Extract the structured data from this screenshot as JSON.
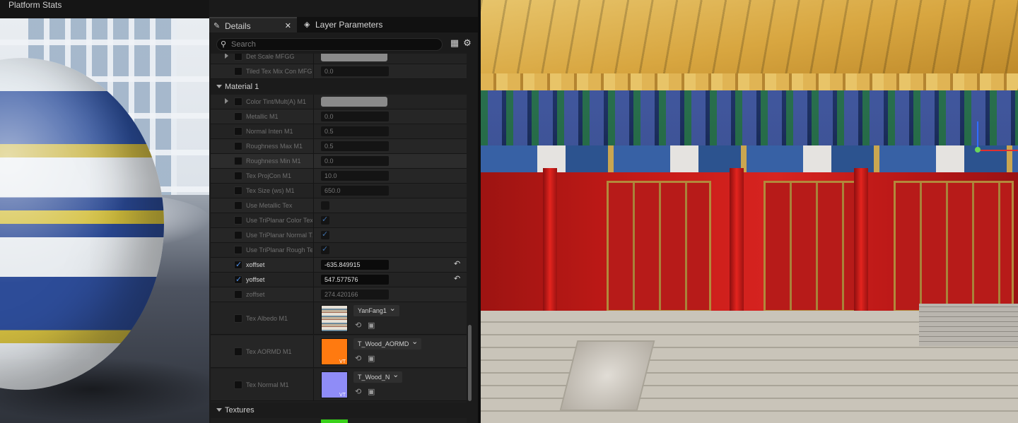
{
  "left_viewport": {
    "title": "Platform Stats"
  },
  "details_panel": {
    "tabs": [
      {
        "label": "Details",
        "icon": "pencil-icon",
        "closable": true
      },
      {
        "label": "Layer Parameters",
        "icon": "layers-icon"
      }
    ],
    "search": {
      "placeholder": "Search"
    },
    "toolbar_icons": [
      "table-view-icon",
      "settings-gear-icon"
    ],
    "rows_top": [
      {
        "label": "Det Scale MFGG",
        "type": "color"
      },
      {
        "label": "Tiled Tex Mix Con MFGG",
        "type": "number",
        "value": "0.0"
      }
    ],
    "category_material": {
      "label": "Material 1"
    },
    "material_rows": [
      {
        "label": "Color Tint/Mult(A) M1",
        "type": "color",
        "expandable": true
      },
      {
        "label": "Metallic M1",
        "type": "number",
        "value": "0.0"
      },
      {
        "label": "Normal Inten M1",
        "type": "number",
        "value": "0.5"
      },
      {
        "label": "Roughness Max M1",
        "type": "number",
        "value": "0.5"
      },
      {
        "label": "Roughness Min M1",
        "type": "number",
        "value": "0.0"
      },
      {
        "label": "Tex ProjCon M1",
        "type": "number",
        "value": "10.0"
      },
      {
        "label": "Tex Size (ws) M1",
        "type": "number",
        "value": "650.0"
      },
      {
        "label": "Use Metallic Tex",
        "type": "bool",
        "value": false
      },
      {
        "label": "Use TriPlanar Color Tex",
        "type": "bool",
        "value": true
      },
      {
        "label": "Use TriPlanar Normal T...",
        "type": "bool",
        "value": true
      },
      {
        "label": "Use TriPlanar Rough Tex",
        "type": "bool",
        "value": true
      },
      {
        "label": "xoffset",
        "type": "number",
        "value": "-635.849915",
        "active": true,
        "resettable": true
      },
      {
        "label": "yoffset",
        "type": "number",
        "value": "547.577576",
        "active": true,
        "resettable": true
      },
      {
        "label": "zoffset",
        "type": "number",
        "value": "274.420166"
      }
    ],
    "texture_rows": [
      {
        "label": "Tex Albedo M1",
        "asset": "YanFang1",
        "thumb": "albedo"
      },
      {
        "label": "Tex AORMD M1",
        "asset": "T_Wood_AORMD",
        "thumb": "aormd",
        "badge": "VT"
      },
      {
        "label": "Tex Normal M1",
        "asset": "T_Wood_N",
        "thumb": "normal",
        "badge": "VT"
      }
    ],
    "category_textures": {
      "label": "Textures"
    },
    "asset_icons": [
      "browse-arrow-icon",
      "open-folder-icon"
    ]
  },
  "colors": {
    "panel_bg": "#1b1b1b",
    "checkbox_accent": "#4d8ee8",
    "colorbar_grey": "#8a8a8a"
  }
}
